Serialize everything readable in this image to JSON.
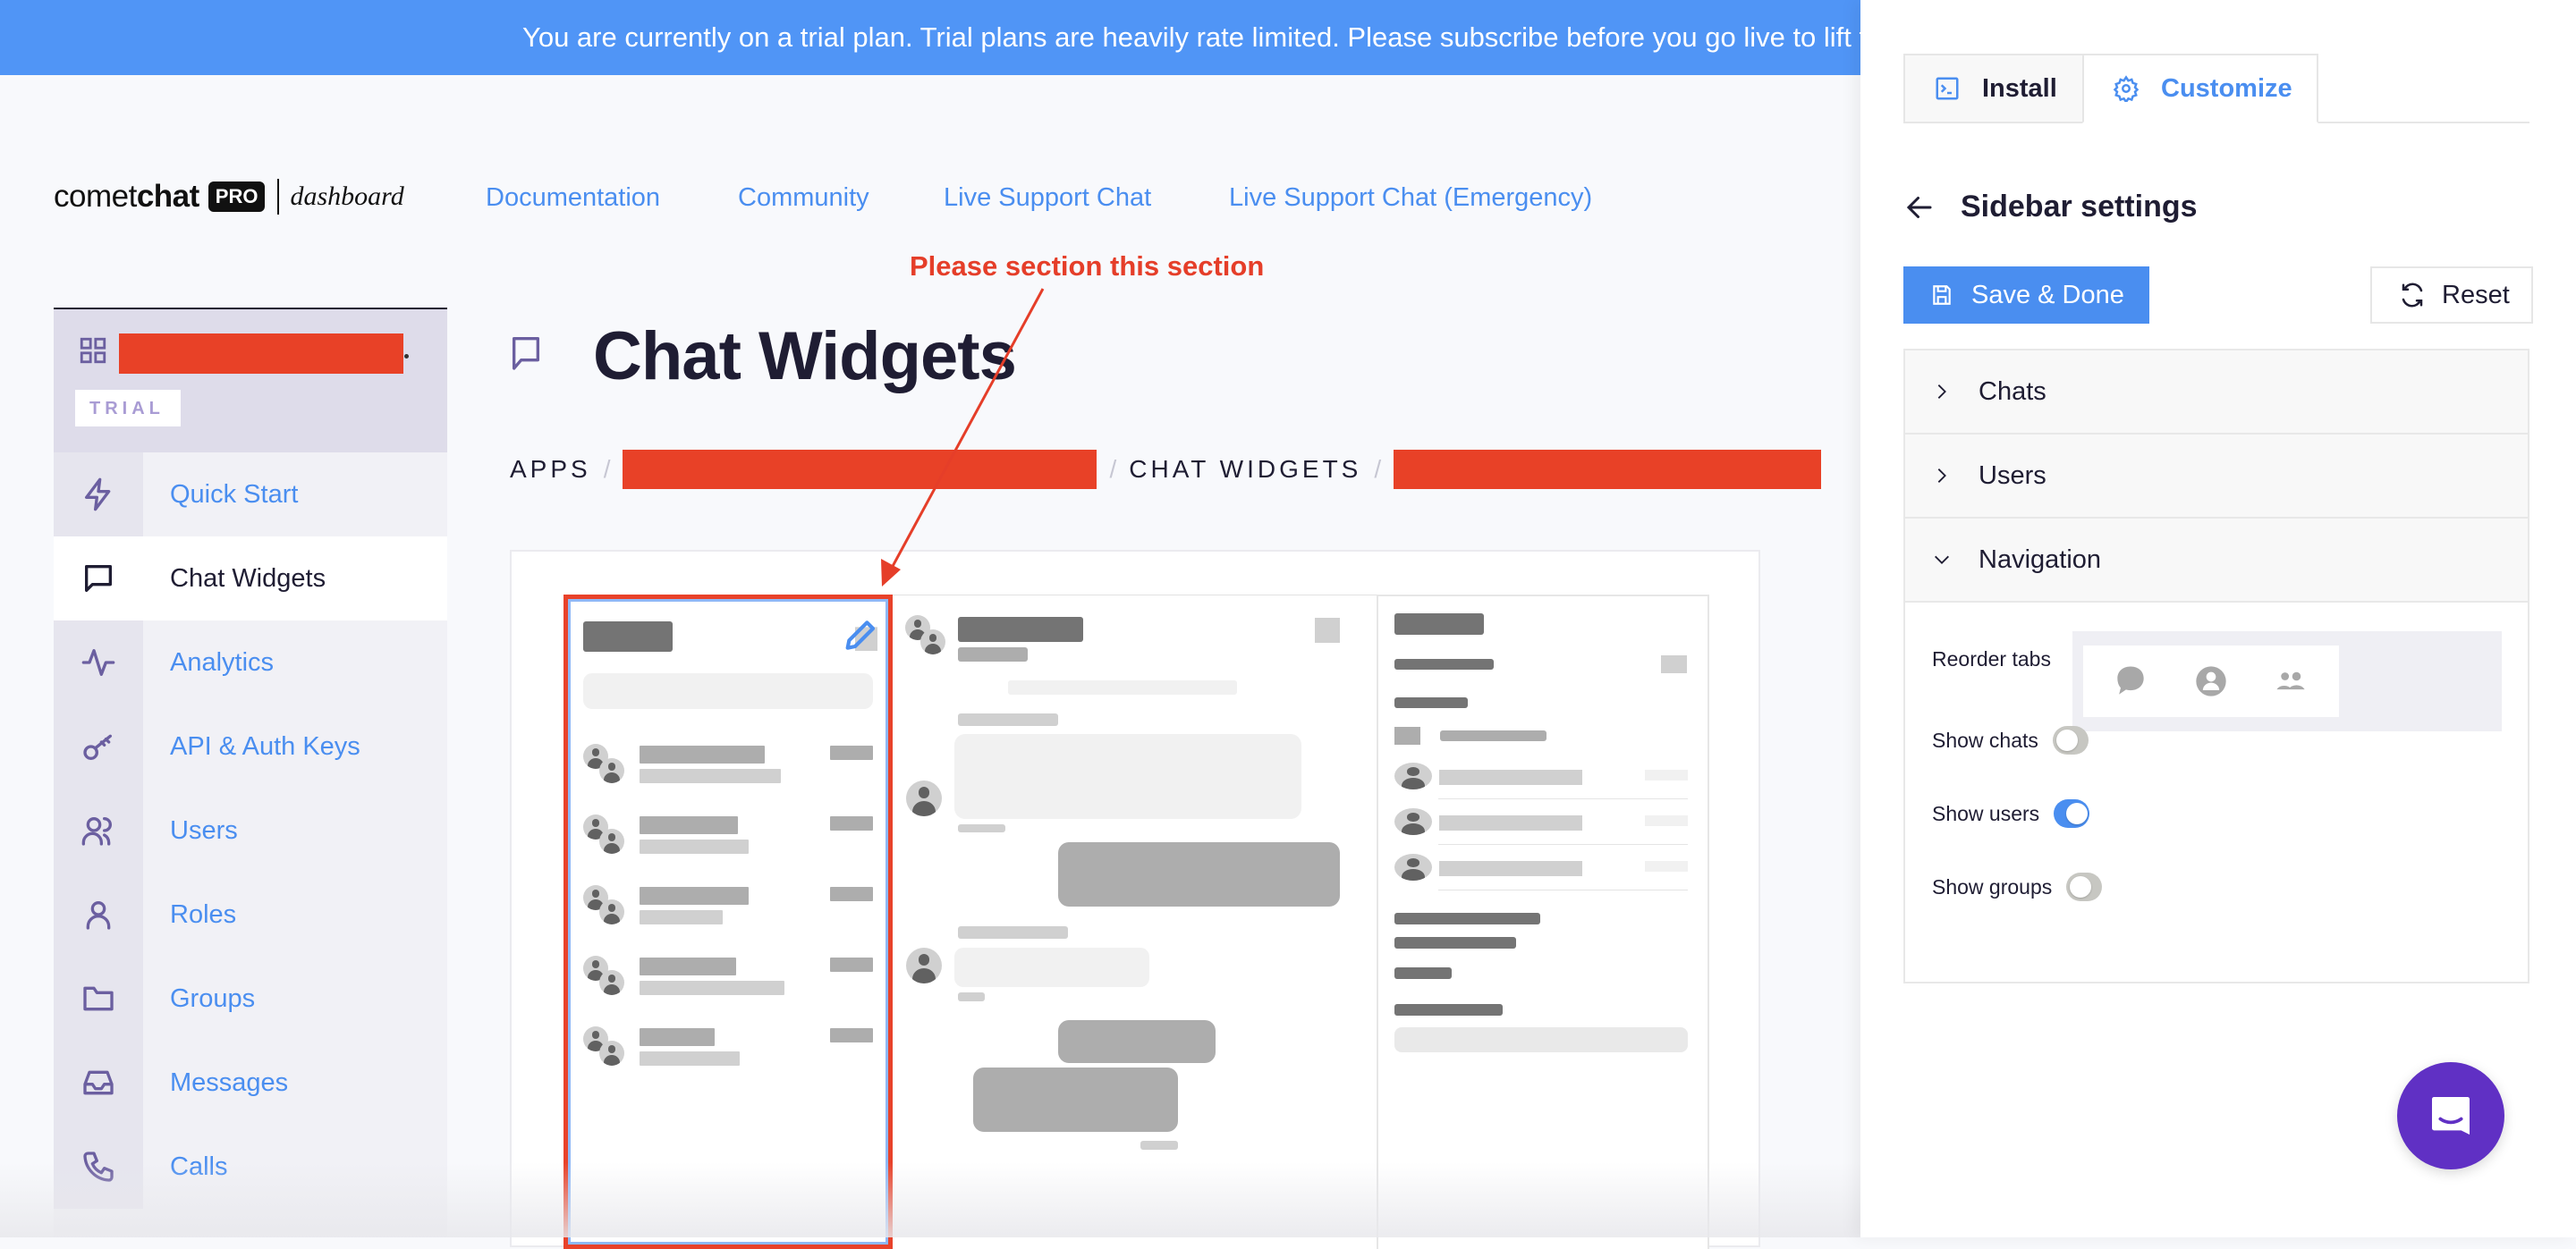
{
  "banner": {
    "text": "You are currently on a trial plan. Trial plans are heavily rate limited. Please subscribe before you go live to lift these"
  },
  "logo": {
    "brand_light": "comet",
    "brand_bold": "chat",
    "badge": "PRO",
    "suffix": "dashboard"
  },
  "nav": {
    "links": [
      "Documentation",
      "Community",
      "Live Support Chat",
      "Live Support Chat (Emergency)"
    ]
  },
  "sidebar": {
    "app_name": "[redacted]",
    "plan_badge": "TRIAL",
    "items": [
      {
        "label": "Quick Start",
        "icon": "lightning-icon",
        "active": false
      },
      {
        "label": "Chat Widgets",
        "icon": "chat-bubble-icon",
        "active": true
      },
      {
        "label": "Analytics",
        "icon": "activity-icon",
        "active": false
      },
      {
        "label": "API & Auth Keys",
        "icon": "key-icon",
        "active": false
      },
      {
        "label": "Users",
        "icon": "users-icon",
        "active": false
      },
      {
        "label": "Roles",
        "icon": "user-icon",
        "active": false
      },
      {
        "label": "Groups",
        "icon": "folder-icon",
        "active": false
      },
      {
        "label": "Messages",
        "icon": "inbox-icon",
        "active": false
      },
      {
        "label": "Calls",
        "icon": "phone-icon",
        "active": false
      }
    ]
  },
  "page": {
    "title": "Chat Widgets",
    "breadcrumb": [
      "APPS",
      "[redacted]",
      "CHAT WIDGETS",
      "[redacted]"
    ]
  },
  "annotation": {
    "text": "Please section this section",
    "color": "#e53e29"
  },
  "panel": {
    "tabs": [
      {
        "label": "Install",
        "icon": "terminal-icon",
        "active": false
      },
      {
        "label": "Customize",
        "icon": "gear-icon",
        "active": true
      }
    ],
    "title": "Sidebar settings",
    "save_label": "Save & Done",
    "reset_label": "Reset",
    "accordion": [
      {
        "label": "Chats",
        "expanded": false
      },
      {
        "label": "Users",
        "expanded": false
      },
      {
        "label": "Navigation",
        "expanded": true
      }
    ],
    "navigation": {
      "reorder_label": "Reorder tabs",
      "reorder_tabs": [
        "chats-tab",
        "users-tab",
        "groups-tab"
      ],
      "toggles": [
        {
          "label": "Show chats",
          "on": false
        },
        {
          "label": "Show users",
          "on": true
        },
        {
          "label": "Show groups",
          "on": false
        }
      ]
    }
  },
  "colors": {
    "accent": "#4a8ef0",
    "banner": "#5095f6",
    "redaction": "#e84127",
    "launcher": "#6030c4",
    "icon_purple": "#6b5fa0"
  }
}
